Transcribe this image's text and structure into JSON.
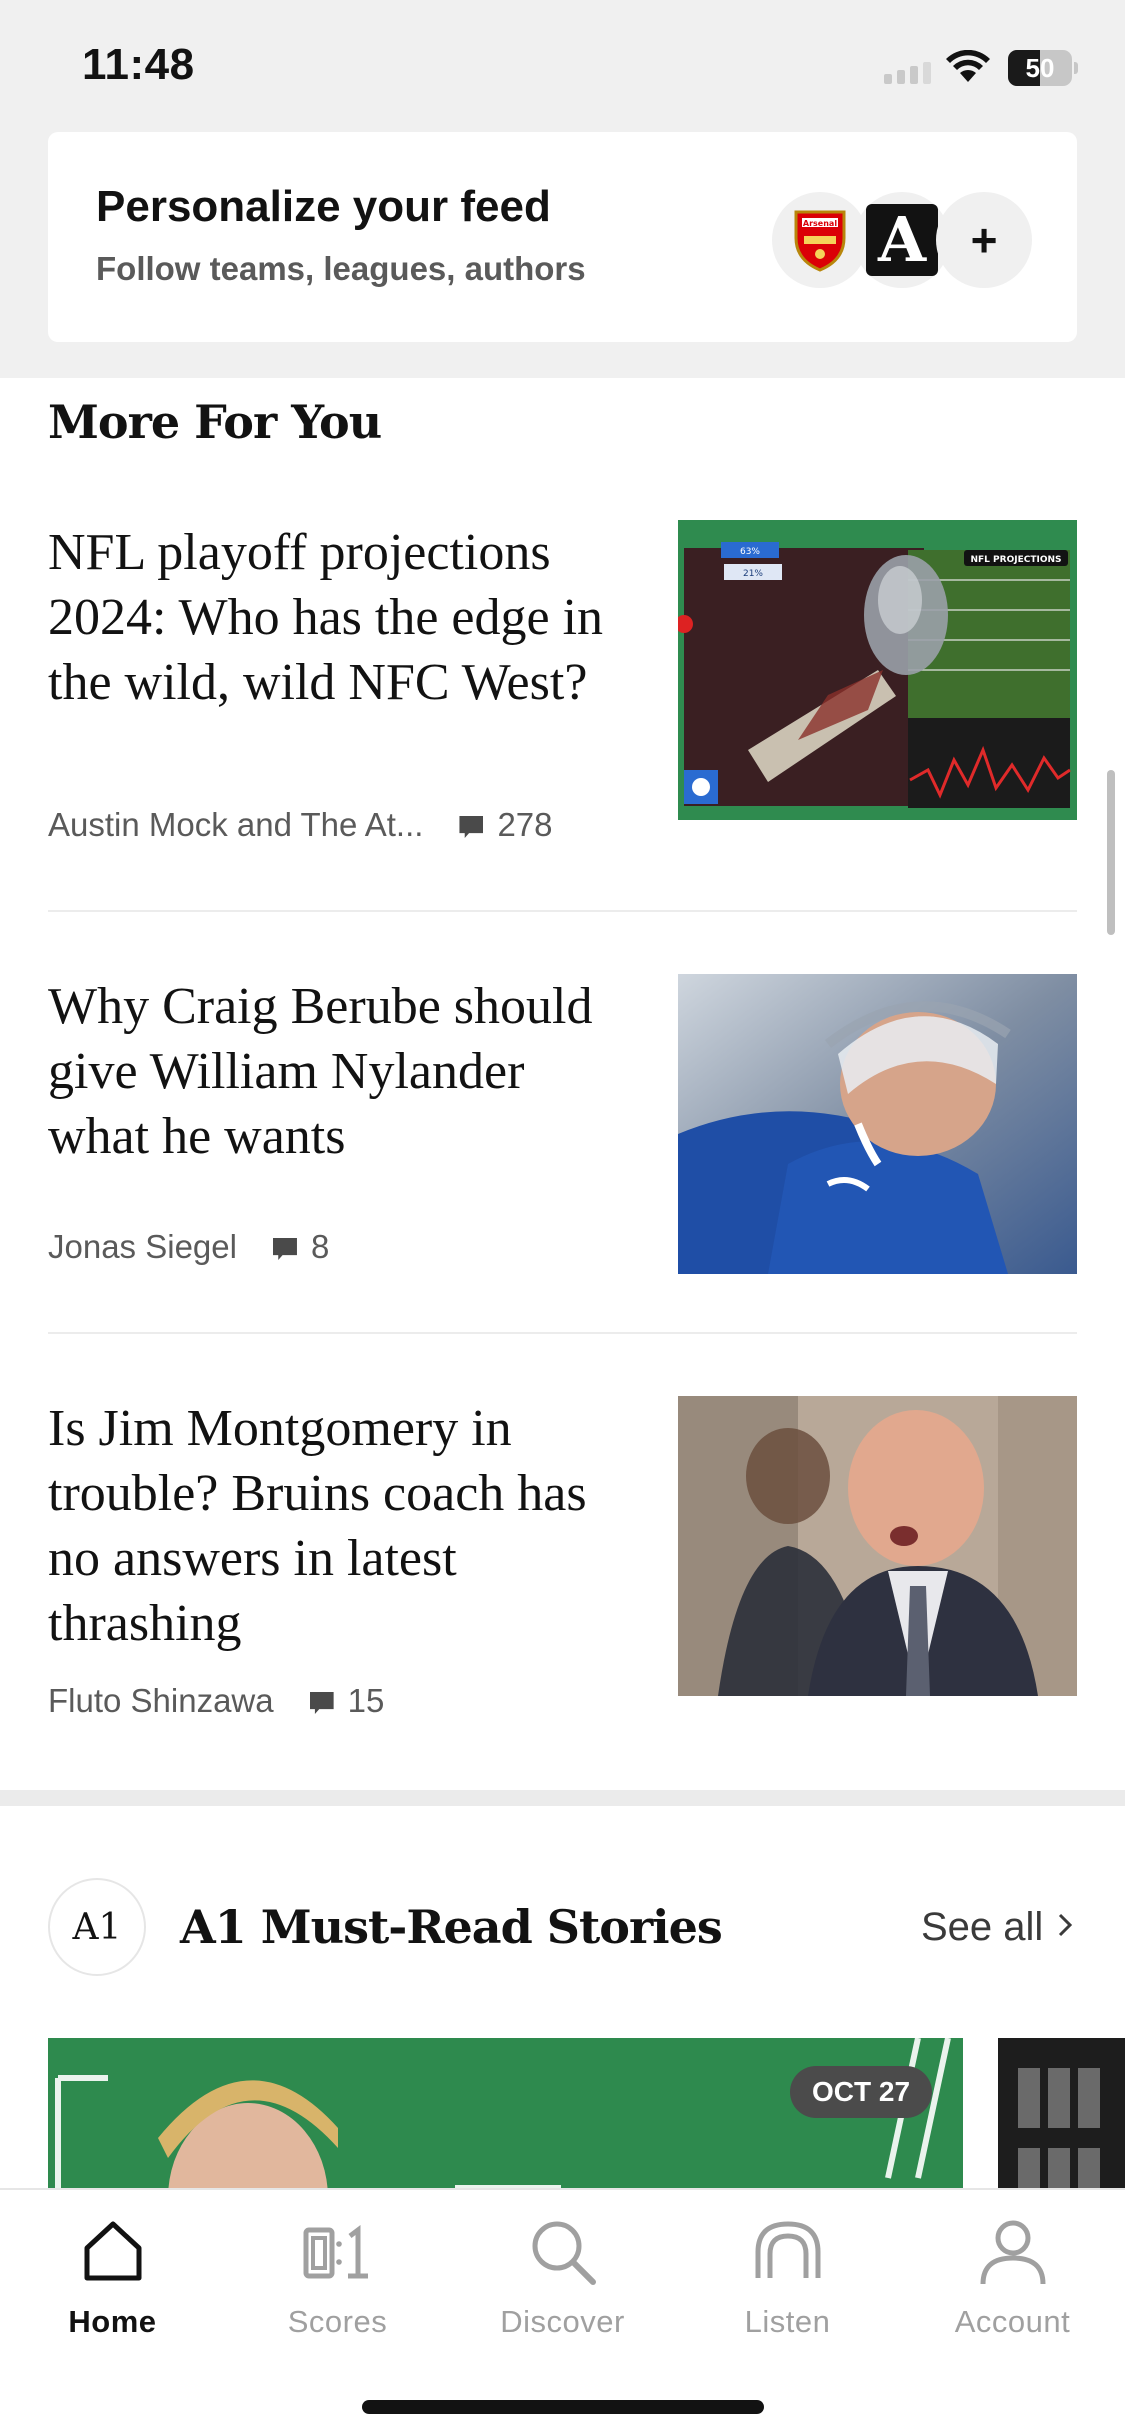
{
  "status_bar": {
    "time": "11:48",
    "battery": "50",
    "battery_fill": 0.5
  },
  "personalize": {
    "title": "Personalize your feed",
    "subtitle": "Follow teams, leagues, authors",
    "chips": [
      "arsenal-crest",
      "athletic-logo"
    ],
    "add_label": "+",
    "athletic_letter": "A",
    "arsenal_text": "Arsenal"
  },
  "more_for_you": {
    "title": "More For You",
    "articles": [
      {
        "headline": "NFL playoff projections 2024: Who has the edge in the wild, wild NFC West?",
        "author": "Austin Mock and The At...",
        "comments": "278",
        "image": "nfl-projections",
        "image_badge": "NFL PROJECTIONS",
        "image_stats": [
          "63%",
          "21%"
        ]
      },
      {
        "headline": "Why Craig Berube should give William Nylander what he wants",
        "author": "Jonas Siegel",
        "comments": "8",
        "image": "hockey-player"
      },
      {
        "headline": "Is Jim Montgomery in trouble? Bruins coach has no answers in latest thrashing",
        "author": "Fluto Shinzawa",
        "comments": "15",
        "image": "hockey-coach"
      }
    ]
  },
  "a1": {
    "logo": "A1",
    "title": "A1 Must-Read Stories",
    "see_all": "See all",
    "card_date": "OCT 27"
  },
  "tabs": [
    {
      "label": "Home",
      "icon": "home-icon",
      "active": true
    },
    {
      "label": "Scores",
      "icon": "scores-icon",
      "active": false
    },
    {
      "label": "Discover",
      "icon": "discover-icon",
      "active": false
    },
    {
      "label": "Listen",
      "icon": "listen-icon",
      "active": false
    },
    {
      "label": "Account",
      "icon": "account-icon",
      "active": false
    }
  ],
  "colors": {
    "accent": "#121212",
    "inactive": "#a0a0a0",
    "card_green": "#2f8b4f",
    "background_gray": "#f0f0f0"
  }
}
